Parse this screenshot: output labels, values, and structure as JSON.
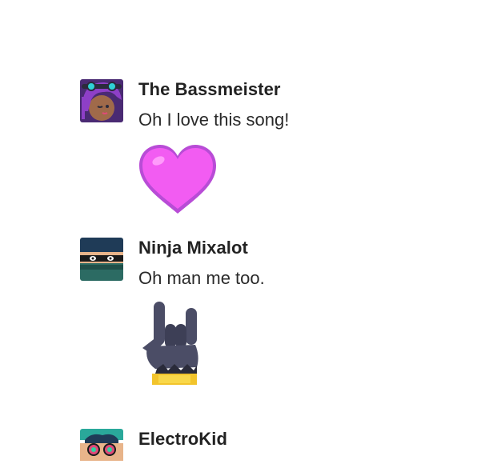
{
  "messages": [
    {
      "author": "The Bassmeister",
      "text": "Oh I love this song!",
      "avatar_icon": "bassmeister-avatar-icon",
      "sticker_icon": "heart-sticker-icon",
      "sticker_color": "#f25cf2"
    },
    {
      "author": "Ninja Mixalot",
      "text": "Oh man me too.",
      "avatar_icon": "ninja-avatar-icon",
      "sticker_icon": "rock-hand-sticker-icon",
      "sticker_color": "#4b4d66"
    },
    {
      "author": "ElectroKid",
      "text": "",
      "avatar_icon": "electrokid-avatar-icon"
    }
  ]
}
